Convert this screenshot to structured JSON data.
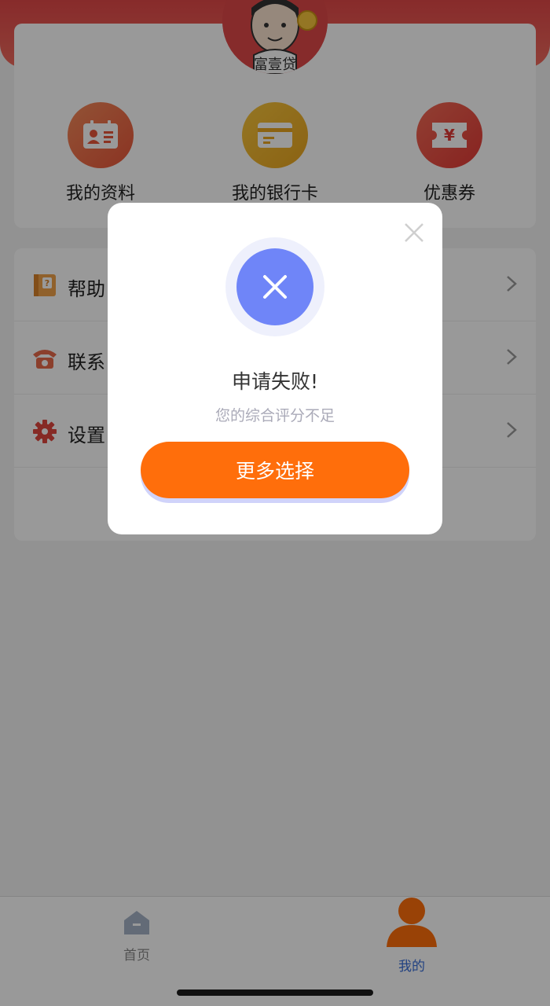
{
  "app": {
    "name": "富壹贷"
  },
  "quick_actions": [
    {
      "label": "我的资料",
      "icon": "id-card-icon"
    },
    {
      "label": "我的银行卡",
      "icon": "bank-card-icon"
    },
    {
      "label": "优惠券",
      "icon": "coupon-icon"
    }
  ],
  "menu": [
    {
      "label": "帮助",
      "icon": "help-book-icon"
    },
    {
      "label": "联系",
      "icon": "phone-icon"
    },
    {
      "label": "设置",
      "icon": "gear-icon"
    }
  ],
  "modal": {
    "title": "申请失败!",
    "subtitle": "您的综合评分不足",
    "button_label": "更多选择"
  },
  "tabbar": {
    "home_label": "首页",
    "mine_label": "我的"
  },
  "colors": {
    "brand_red": "#e24848",
    "button_orange": "#ff6e0b",
    "fail_blue": "#6f85f8",
    "active_tab_blue": "#3a6fd8"
  }
}
